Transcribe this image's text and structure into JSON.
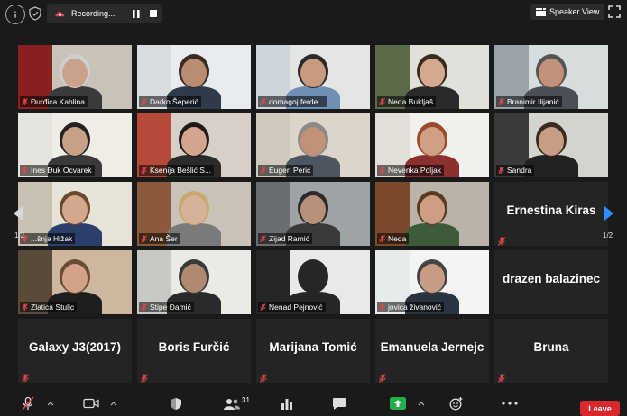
{
  "topbar": {
    "recording_label": "Recording...",
    "view_label": "Speaker View",
    "icons": [
      "info-icon",
      "shield-icon",
      "record-icon",
      "pause-icon",
      "stop-icon",
      "grid-icon",
      "fullscreen-icon"
    ]
  },
  "pagination": {
    "left": "1/2",
    "right": "1/2"
  },
  "participants": [
    {
      "name": "Đurđica Kahlina",
      "video": true,
      "muted": true,
      "active": true,
      "bg": "#8a1f1f",
      "wall": "#c9c2b8",
      "skin": "#caa28c",
      "shirt": "#3a3a3a",
      "hair": "#cfcfcf"
    },
    {
      "name": "Darko Šeperić",
      "video": true,
      "muted": true,
      "bg": "#d9dde0",
      "wall": "#e8ecef",
      "skin": "#b98d72",
      "shirt": "#2f3b4a",
      "hair": "#3a2a20"
    },
    {
      "name": "domagoj ferde...",
      "video": true,
      "muted": true,
      "bg": "#cfd6db",
      "wall": "#e3e6e2",
      "skin": "#c89a80",
      "shirt": "#6f8fb5",
      "hair": "#2a2a2a"
    },
    {
      "name": "Neda Bukljaš",
      "video": true,
      "muted": true,
      "bg": "#5b6b4a",
      "wall": "#e2e0da",
      "skin": "#d5a98d",
      "shirt": "#2a2a2a",
      "hair": "#3b2a1e"
    },
    {
      "name": "Branimir Ilijanić",
      "video": true,
      "muted": true,
      "bg": "#9aa3a8",
      "wall": "#d7dcdc",
      "skin": "#c2917a",
      "shirt": "#4a4f55",
      "hair": "#555"
    },
    {
      "name": "Ines Đuk Ocvarek",
      "video": true,
      "muted": true,
      "bg": "#e6e4de",
      "wall": "#efede6",
      "skin": "#c8a088",
      "shirt": "#3a3a3a",
      "hair": "#222"
    },
    {
      "name": "Ksenija Bešlić S...",
      "video": true,
      "muted": true,
      "bg": "#b54a3a",
      "wall": "#d6d0c8",
      "skin": "#d2a58c",
      "shirt": "#2a2a2a",
      "hair": "#1f1a16"
    },
    {
      "name": "Eugen Perić",
      "video": true,
      "muted": true,
      "bg": "#cfc9bd",
      "wall": "#dcd6ca",
      "skin": "#c29278",
      "shirt": "#4d5660",
      "hair": "#8a8a8a"
    },
    {
      "name": "Nevenka Poljak",
      "video": true,
      "muted": true,
      "bg": "#e2dfd8",
      "wall": "#f1f0ec",
      "skin": "#cf9f86",
      "shirt": "#8b2f2f",
      "hair": "#9b4a2a"
    },
    {
      "name": "Sandra",
      "video": true,
      "muted": true,
      "bg": "#3a3a3a",
      "wall": "#d4d4cf",
      "skin": "#c79d86",
      "shirt": "#222",
      "hair": "#3a2a20"
    },
    {
      "name": "...šnja Hižak",
      "video": true,
      "muted": true,
      "bg": "#c9c2b2",
      "wall": "#e8e3d8",
      "skin": "#d4a88e",
      "shirt": "#2c3e6a",
      "hair": "#6b4a2a"
    },
    {
      "name": "Ana Šer",
      "video": true,
      "muted": true,
      "bg": "#8a5a3a",
      "wall": "#c9c2b8",
      "skin": "#d7b29a",
      "shirt": "#7a7a7a",
      "hair": "#c9a870"
    },
    {
      "name": "Zijad Ramić",
      "video": true,
      "muted": true,
      "bg": "#6a6e70",
      "wall": "#9ea3a5",
      "skin": "#b88f78",
      "shirt": "#3a3a3a",
      "hair": "#2a2a2a"
    },
    {
      "name": "Neda",
      "video": true,
      "muted": true,
      "bg": "#7a4a2a",
      "wall": "#b9b3a8",
      "skin": "#cf9d84",
      "shirt": "#3e5a3a",
      "hair": "#5a3a22"
    },
    {
      "name": "Ernestina Kiras",
      "video": false,
      "muted": true
    },
    {
      "name": "Zlatica Stulic",
      "video": true,
      "muted": true,
      "bg": "#5a4a3a",
      "wall": "#cdb79e",
      "skin": "#d1a48a",
      "shirt": "#1e1e1e",
      "hair": "#6b4b33"
    },
    {
      "name": "Stipe Đamić",
      "video": true,
      "muted": true,
      "bg": "#c9c9c4",
      "wall": "#ebebe6",
      "skin": "#b08a70",
      "shirt": "#2a2a2a",
      "hair": "#3a3a3a"
    },
    {
      "name": "Nenad Pejnović",
      "video": true,
      "muted": true,
      "bg": "#262626",
      "wall": "#e9e9e9",
      "skin": "#262626",
      "shirt": "#262626",
      "hair": "#262626"
    },
    {
      "name": "jovica živanović",
      "video": true,
      "muted": true,
      "bg": "#e7ebec",
      "wall": "#f3f5f5",
      "skin": "#c89c84",
      "shirt": "#2a3340",
      "hair": "#444"
    },
    {
      "name": "drazen balazinec",
      "video": false,
      "muted": false
    },
    {
      "name": "Galaxy J3(2017)",
      "video": false,
      "muted": true
    },
    {
      "name": "Boris Furčić",
      "video": false,
      "muted": true
    },
    {
      "name": "Marijana Tomić",
      "video": false,
      "muted": true
    },
    {
      "name": "Emanuela Jernejc",
      "video": false,
      "muted": true
    },
    {
      "name": "Bruna",
      "video": false,
      "muted": true
    }
  ],
  "bottombar": {
    "participants_count": "31",
    "leave_label": "Leave",
    "icons": [
      "mic-muted-icon",
      "chevron-up-icon",
      "video-icon",
      "chevron-up-icon",
      "security-icon",
      "participants-icon",
      "polls-icon",
      "chat-icon",
      "share-screen-icon",
      "chevron-up-icon",
      "reactions-icon",
      "more-icon"
    ]
  }
}
